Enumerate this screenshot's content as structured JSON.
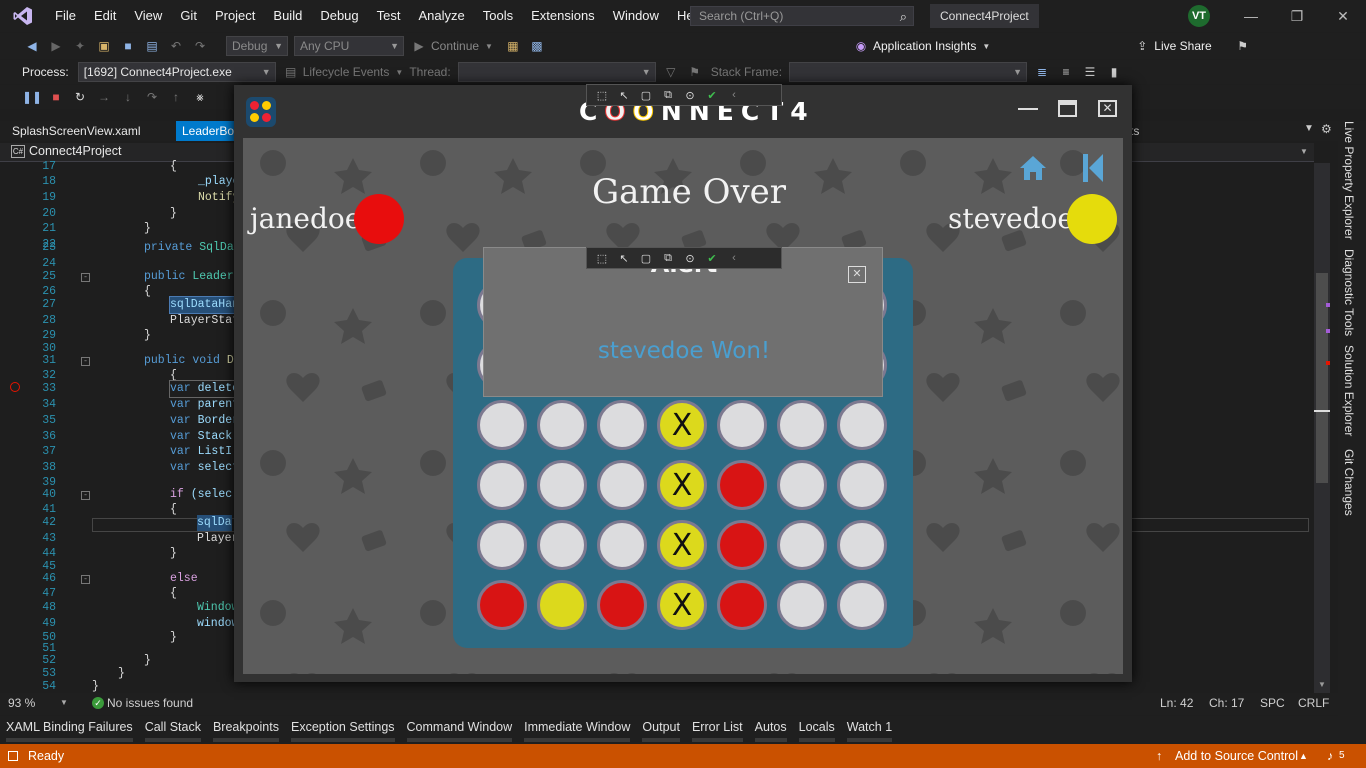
{
  "menubar": {
    "items": [
      "File",
      "Edit",
      "View",
      "Git",
      "Project",
      "Build",
      "Debug",
      "Test",
      "Analyze",
      "Tools",
      "Extensions",
      "Window",
      "Help"
    ],
    "search_placeholder": "Search (Ctrl+Q)",
    "project_title": "Connect4Project",
    "avatar_initials": "VT"
  },
  "toolbar": {
    "config": "Debug",
    "platform": "Any CPU",
    "continue_label": "Continue",
    "app_insights": "Application Insights",
    "live_share": "Live Share"
  },
  "debugbar": {
    "process_label": "Process:",
    "process_value": "[1692] Connect4Project.exe",
    "lifecycle_label": "Lifecycle Events",
    "thread_label": "Thread:",
    "stackframe_label": "Stack Frame:"
  },
  "tabs": {
    "tab1": "SplashScreenView.xaml",
    "tab2": "LeaderBo",
    "tab3": "ts"
  },
  "navbar": {
    "project": "Connect4Project"
  },
  "code": {
    "line_numbers": [
      "17",
      "18",
      "19",
      "20",
      "21",
      "22",
      "23",
      "24",
      "25",
      "26",
      "27",
      "28",
      "29",
      "30",
      "31",
      "32",
      "33",
      "34",
      "35",
      "36",
      "37",
      "38",
      "39",
      "40",
      "41",
      "42",
      "43",
      "44",
      "45",
      "46",
      "47",
      "48",
      "49",
      "50",
      "51",
      "52",
      "53",
      "54"
    ],
    "lines": {
      "l17": "{",
      "l18": "_playe",
      "l19": "Notify",
      "l20": "}",
      "l21": "}",
      "l23a": "private",
      "l23b": "SqlDat",
      "l25a": "public",
      "l25b": "Leader",
      "l26": "{",
      "l27": "sqlDataHan",
      "l28": "PlayerStat",
      "l29": "}",
      "l31a": "public",
      "l31b": "void",
      "l31c": "De",
      "l32": "{",
      "l33a": "var",
      "l33b": "delete",
      "l34a": "var",
      "l34b": "parent",
      "l35a": "var",
      "l35b": "Border",
      "l36a": "var",
      "l36b": "Stack",
      "l37a": "var",
      "l37b": "ListI",
      "l38a": "var",
      "l38b": "select",
      "l40a": "if",
      "l40b": "(selec",
      "l41": "{",
      "l42": "sqlDa",
      "l43": "Player",
      "l44": "}",
      "l46": "else",
      "l47": "{",
      "l48": "Window",
      "l49": "window",
      "l50": "}",
      "l52": "}",
      "l53": "}",
      "l54": "}"
    }
  },
  "status1": {
    "zoom": "93 %",
    "issues": "No issues found",
    "ln": "Ln: 42",
    "ch": "Ch: 17",
    "spc": "SPC",
    "crlf": "CRLF"
  },
  "bottom_tabs": [
    "XAML Binding Failures",
    "Call Stack",
    "Breakpoints",
    "Exception Settings",
    "Command Window",
    "Immediate Window",
    "Output",
    "Error List",
    "Autos",
    "Locals",
    "Watch 1"
  ],
  "right_tabs": [
    "Live Property Explorer",
    "Diagnostic Tools",
    "Solution Explorer",
    "Git Changes"
  ],
  "statusbar": {
    "ready": "Ready",
    "source_control": "Add to Source Control",
    "notif_count": "5"
  },
  "app": {
    "title_prefix": "C",
    "title_o1": "O",
    "title_o2": "O",
    "title_suffix": "NNECT4",
    "game_status": "Game Over",
    "player1": "janedoe",
    "player2": "stevedoe",
    "alert_title": "Alert",
    "alert_message": "stevedoe Won!",
    "board": [
      [
        "e",
        "e",
        "e",
        "e",
        "e",
        "e",
        "e"
      ],
      [
        "e",
        "e",
        "e",
        "e",
        "e",
        "e",
        "e"
      ],
      [
        "e",
        "e",
        "e",
        "yx",
        "e",
        "e",
        "e"
      ],
      [
        "e",
        "e",
        "e",
        "yx",
        "r",
        "e",
        "e"
      ],
      [
        "e",
        "e",
        "e",
        "yx",
        "r",
        "e",
        "e"
      ],
      [
        "r",
        "y",
        "r",
        "yx",
        "r",
        "e",
        "e"
      ]
    ],
    "x_mark": "X",
    "colors": {
      "red": "#d81414",
      "yellow": "#dcd91c",
      "board": "#2d6b84",
      "accent": "#5aa6d6"
    }
  }
}
